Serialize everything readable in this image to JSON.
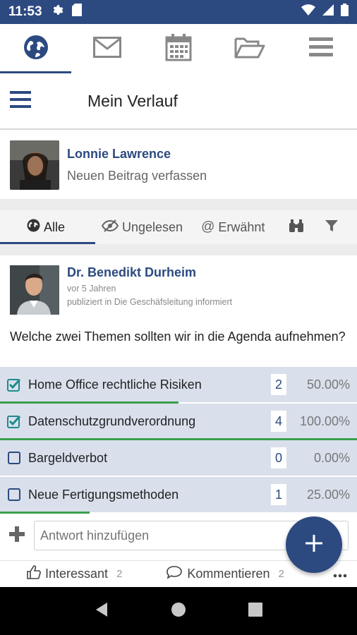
{
  "status_bar": {
    "time": "11:53",
    "icons": [
      "gear-icon",
      "sd-card-icon",
      "wifi-icon",
      "signal-icon",
      "battery-icon"
    ]
  },
  "app_tabs": [
    {
      "icon": "globe-icon",
      "active": true
    },
    {
      "icon": "mail-icon",
      "active": false
    },
    {
      "icon": "calendar-icon",
      "active": false
    },
    {
      "icon": "folder-icon",
      "active": false
    },
    {
      "icon": "hamburger-icon",
      "active": false
    }
  ],
  "header": {
    "title": "Mein Verlauf"
  },
  "composer": {
    "user_name": "Lonnie Lawrence",
    "prompt": "Neuen Beitrag verfassen"
  },
  "filters": [
    {
      "label": "Alle",
      "icon": "globe-icon",
      "active": true
    },
    {
      "label": "Ungelesen",
      "icon": "eye-slash-icon",
      "active": false
    },
    {
      "label": "Erwähnt",
      "icon": "at-icon",
      "active": false
    }
  ],
  "post": {
    "author": "Dr. Benedikt Durheim",
    "time": "vor 5 Jahren",
    "group": "publiziert in Die Geschäfsleitung informiert",
    "question": "Welche zwei Themen sollten wir in die Agenda aufnehmen?",
    "poll_options": [
      {
        "label": "Home Office rechtliche Risiken",
        "count": "2",
        "percent": "50.00%",
        "fraction": 0.5,
        "checked": true
      },
      {
        "label": "Datenschutzgrundverordnung",
        "count": "4",
        "percent": "100.00%",
        "fraction": 1.0,
        "checked": true
      },
      {
        "label": "Bargeldverbot",
        "count": "0",
        "percent": "0.00%",
        "fraction": 0.0,
        "checked": false
      },
      {
        "label": "Neue Fertigungsmethoden",
        "count": "1",
        "percent": "25.00%",
        "fraction": 0.25,
        "checked": false
      }
    ],
    "reply_placeholder": "Antwort hinzufügen",
    "actions": {
      "like_label": "Interessant",
      "like_count": "2",
      "comment_label": "Kommentieren",
      "comment_count": "2"
    }
  },
  "colors": {
    "primary": "#2c4a80",
    "poll_bg": "#d9e0ec",
    "progress": "#3aa04c",
    "checkbox": "#1e8a8a"
  }
}
